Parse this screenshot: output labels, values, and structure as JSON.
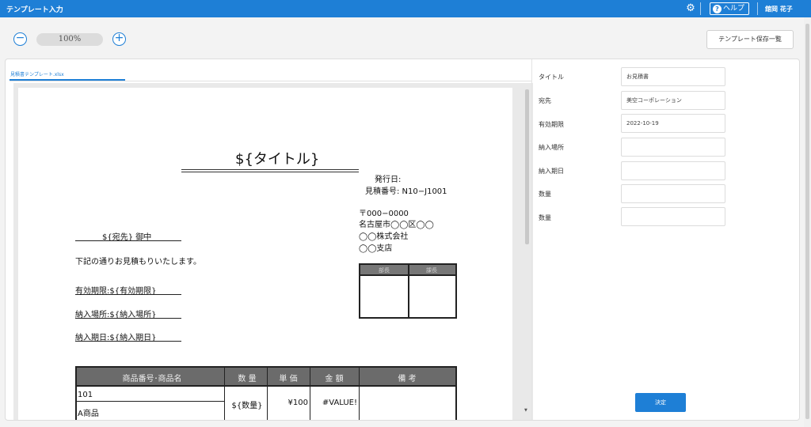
{
  "header": {
    "app_title": "テンプレート入力",
    "help_label": "ヘルプ",
    "help_icon": "?",
    "user_name": "舘岡 花子",
    "settings_icon": "gear-icon"
  },
  "toolbar": {
    "zoom_out_icon": "−",
    "zoom_in_icon": "+",
    "zoom_level": "100%",
    "template_list_label": "テンプレート保存一覧"
  },
  "sheet": {
    "tab_label": "見積書テンプレート.xlsx",
    "title": "${タイトル}",
    "issue_date_label": "発行日:",
    "quote_no": "見積番号: N10−J1001",
    "postal": "〒000−0000",
    "address": "名古屋市◯◯区◯◯",
    "company": "◯◯株式会社",
    "branch": "◯◯支店",
    "recipient": "${宛先}  御中",
    "intro": "下記の通りお見積もりいたします。",
    "valid_until": "有効期限:${有効期限}",
    "delivery_place": "納入場所:${納入場所}",
    "delivery_date": "納入期日:${納入期日}",
    "stamp_headers": [
      "部長",
      "課長"
    ],
    "item_headers": [
      "商品番号･商品名",
      "数 量",
      "単 価",
      "金 額",
      "備 考"
    ],
    "item_row": {
      "code": "101",
      "name": "A商品",
      "quantity": "${数量}",
      "unit_price": "¥100",
      "amount": "#VALUE!",
      "note": ""
    }
  },
  "form": {
    "fields": [
      {
        "label": "タイトル",
        "value": "お見積書"
      },
      {
        "label": "宛先",
        "value": "美空コーポレーション"
      },
      {
        "label": "有効期限",
        "value": "2022-10-19"
      },
      {
        "label": "納入場所",
        "value": ""
      },
      {
        "label": "納入期日",
        "value": ""
      },
      {
        "label": "数量",
        "value": ""
      },
      {
        "label": "数量",
        "value": ""
      }
    ],
    "submit_label": "決定"
  }
}
